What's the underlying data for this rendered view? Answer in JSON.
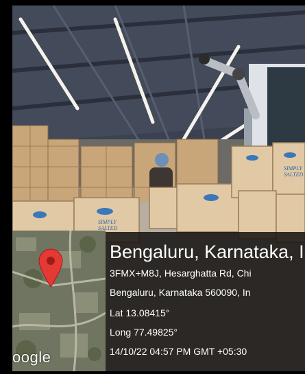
{
  "location": {
    "title": "Bengaluru, Karnataka, I",
    "address_line1": "3FMX+M8J, Hesarghatta Rd, Chi",
    "address_line2": "Bengaluru, Karnataka 560090, In",
    "latitude": "Lat 13.08415°",
    "longitude": "Long 77.49825°",
    "timestamp": "14/10/22 04:57 PM GMT +05:30"
  },
  "map": {
    "attribution": "oogle",
    "pin_color": "#e53935"
  },
  "carton_label": {
    "line1": "SIMPLY",
    "line2": "SALTED"
  }
}
